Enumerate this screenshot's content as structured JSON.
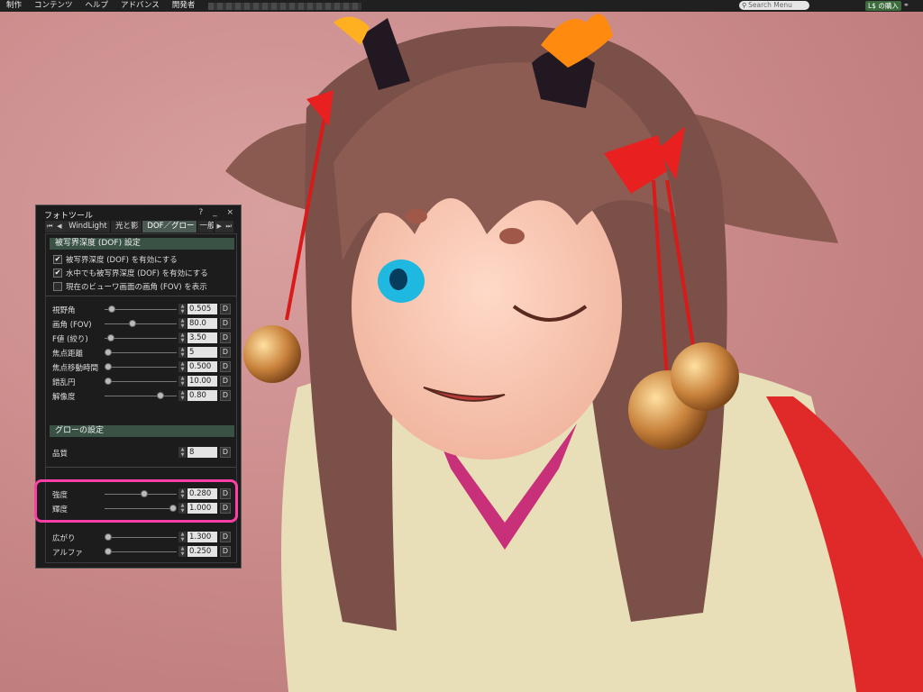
{
  "menubar": {
    "items": [
      "制作",
      "コンテンツ",
      "ヘルプ",
      "アドバンス",
      "開発者"
    ],
    "search_placeholder": "Search Menu",
    "buy_label": "L$ の購入"
  },
  "panel": {
    "title": "フォトツール",
    "controls": "? _ ×",
    "tabs": [
      "WindLight",
      "光と影",
      "DOF／グロー",
      "一般"
    ],
    "active_tab": "DOF／グロー",
    "dof": {
      "header": "被写界深度 (DOF) 設定",
      "checks": [
        {
          "label": "被写界深度 (DOF) を有効にする",
          "checked": true
        },
        {
          "label": "水中でも被写界深度 (DOF) を有効にする",
          "checked": true
        },
        {
          "label": "現在のビューワ画面の画角 (FOV) を表示",
          "checked": false
        }
      ],
      "rows": [
        {
          "label": "視野角",
          "value": "0.505",
          "pos": 0.06
        },
        {
          "label": "画角 (FOV)",
          "value": "80.0",
          "pos": 0.38
        },
        {
          "label": "F値 (絞り)",
          "value": "3.50",
          "pos": 0.04
        },
        {
          "label": "焦点距離",
          "value": "5",
          "pos": 0.0
        },
        {
          "label": "焦点移動時間",
          "value": "0.500",
          "pos": 0.0
        },
        {
          "label": "錯乱円",
          "value": "10.00",
          "pos": 0.0
        },
        {
          "label": "解像度",
          "value": "0.80",
          "pos": 0.8
        }
      ]
    },
    "glow": {
      "header": "グローの設定",
      "rows": [
        {
          "label": "品質",
          "value": "8",
          "pos": null
        },
        {
          "label": "強度",
          "value": "0.280",
          "pos": 0.55
        },
        {
          "label": "輝度",
          "value": "1.000",
          "pos": 1.0
        },
        {
          "label": "広がり",
          "value": "1.300",
          "pos": 0.0
        },
        {
          "label": "アルファ",
          "value": "0.250",
          "pos": 0.0
        }
      ]
    },
    "default_button": "D"
  }
}
